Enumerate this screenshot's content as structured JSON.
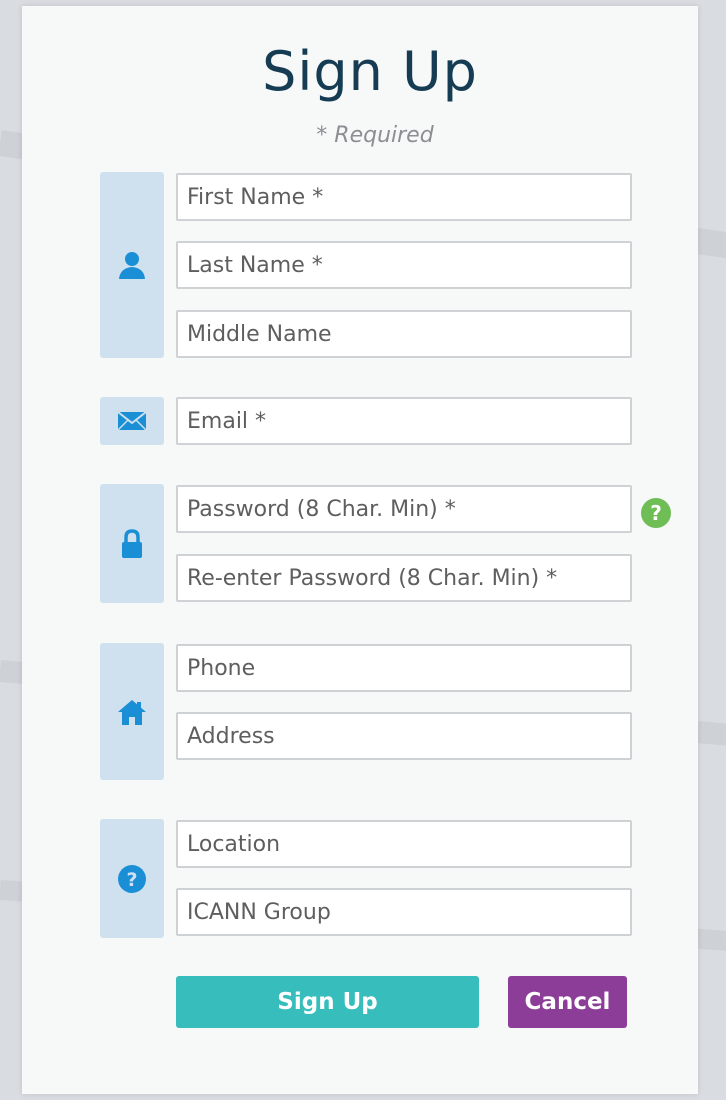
{
  "header": {
    "title": "Sign Up",
    "required_note": "* Required"
  },
  "groups": [
    {
      "icon": "user-icon",
      "fields": [
        {
          "name": "first-name-field",
          "placeholder": "First Name *",
          "value": ""
        },
        {
          "name": "last-name-field",
          "placeholder": "Last Name *",
          "value": ""
        },
        {
          "name": "middle-name-field",
          "placeholder": "Middle Name",
          "value": ""
        }
      ]
    },
    {
      "icon": "envelope-icon",
      "fields": [
        {
          "name": "email-field",
          "placeholder": "Email *",
          "value": ""
        }
      ]
    },
    {
      "icon": "lock-icon",
      "fields": [
        {
          "name": "password-field",
          "placeholder": "Password (8 Char. Min) *",
          "value": ""
        },
        {
          "name": "reenter-password-field",
          "placeholder": "Re-enter Password (8 Char. Min) *",
          "value": ""
        }
      ]
    },
    {
      "icon": "home-icon",
      "fields": [
        {
          "name": "phone-field",
          "placeholder": "Phone",
          "value": ""
        },
        {
          "name": "address-field",
          "placeholder": "Address",
          "value": ""
        }
      ]
    },
    {
      "icon": "question-circle-icon",
      "fields": [
        {
          "name": "location-field",
          "placeholder": "Location",
          "value": ""
        },
        {
          "name": "icann-group-field",
          "placeholder": "ICANN Group",
          "value": ""
        }
      ]
    }
  ],
  "password_help": {
    "label": "?",
    "icon": "help-icon"
  },
  "buttons": {
    "signup_label": "Sign Up",
    "cancel_label": "Cancel"
  },
  "colors": {
    "title": "#163c54",
    "icon_accent": "#1a8fd6",
    "icon_block_bg": "#cfe1ee",
    "help_badge": "#6ebd55",
    "signup_button": "#36bdbc",
    "cancel_button": "#8c3d97"
  }
}
